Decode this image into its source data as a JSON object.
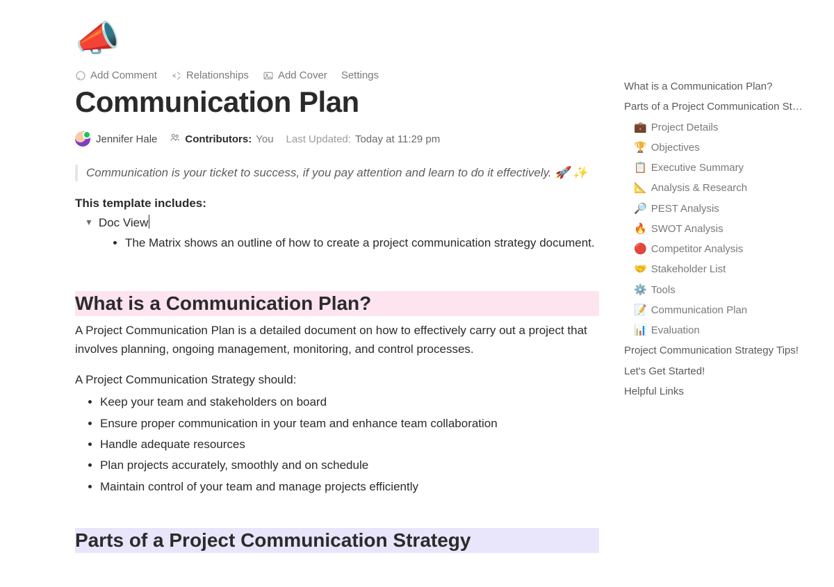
{
  "icon": "📣",
  "toolbar": {
    "add_comment": "Add Comment",
    "relationships": "Relationships",
    "add_cover": "Add Cover",
    "settings": "Settings"
  },
  "title": "Communication Plan",
  "meta": {
    "author": "Jennifer Hale",
    "contributors_label": "Contributors:",
    "contributors_value": "You",
    "last_updated_label": "Last Updated:",
    "last_updated_value": "Today at 11:29 pm"
  },
  "quote": "Communication is your ticket to success, if you pay attention and learn to do it effectively. 🚀 ✨",
  "template_includes_label": "This template includes:",
  "doc_view_label": "Doc View",
  "doc_view_bullets": [
    "The Matrix shows an outline of how to create a project communication strategy document."
  ],
  "section1": {
    "heading": "What is a Communication Plan?",
    "p1": "A Project Communication Plan is a detailed document on how to effectively carry out a project that involves planning, ongoing management, monitoring, and control processes.",
    "p2": "A Project Communication Strategy should:",
    "bullets": [
      "Keep your team and stakeholders on board",
      "Ensure proper communication in your team and enhance team collaboration",
      "Handle adequate resources",
      "Plan projects accurately, smoothly and on schedule",
      "Maintain control of your team and manage projects efficiently"
    ]
  },
  "section2": {
    "heading": "Parts of a Project Communication Strategy"
  },
  "outline": {
    "items": [
      {
        "level": 1,
        "label": "What is a Communication Plan?"
      },
      {
        "level": 1,
        "label": "Parts of a Project Communication St…"
      },
      {
        "level": 2,
        "emoji": "💼",
        "label": "Project Details"
      },
      {
        "level": 2,
        "emoji": "🏆",
        "label": "Objectives"
      },
      {
        "level": 2,
        "emoji": "📋",
        "label": "Executive Summary"
      },
      {
        "level": 2,
        "emoji": "📐",
        "label": "Analysis & Research"
      },
      {
        "level": 2,
        "emoji": "🔎",
        "label": "PEST Analysis"
      },
      {
        "level": 2,
        "emoji": "🔥",
        "label": "SWOT Analysis"
      },
      {
        "level": 2,
        "emoji": "🔴",
        "label": "Competitor Analysis"
      },
      {
        "level": 2,
        "emoji": "🤝",
        "label": "Stakeholder List"
      },
      {
        "level": 2,
        "emoji": "⚙️",
        "label": "Tools"
      },
      {
        "level": 2,
        "emoji": "📝",
        "label": "Communication Plan"
      },
      {
        "level": 2,
        "emoji": "📊",
        "label": "Evaluation"
      },
      {
        "level": 1,
        "label": "Project Communication Strategy Tips!"
      },
      {
        "level": 1,
        "label": "Let's Get Started!"
      },
      {
        "level": 1,
        "label": "Helpful Links"
      }
    ]
  }
}
